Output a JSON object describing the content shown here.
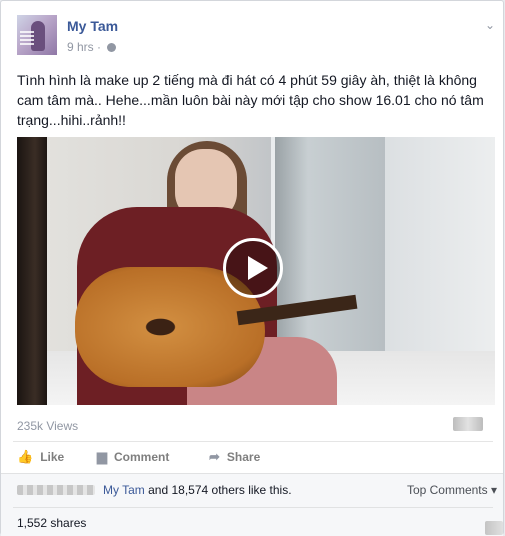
{
  "post": {
    "author": "My Tam",
    "time": "9 hrs",
    "options_icon": "chevron-down-icon",
    "privacy_icon": "globe-icon",
    "text": "Tình hình là make up 2 tiếng mà đi hát có 4 phút 59 giây àh, thiệt là không cam tâm mà.. Hehe...mần luôn bài này mới tập cho show 16.01 cho nó tâm trạng...hihi..rảnh!!",
    "video_views": "235k Views"
  },
  "actions": {
    "like": "Like",
    "comment": "Comment",
    "share": "Share"
  },
  "footer": {
    "likes_name": "My Tam",
    "likes_rest": " and 18,574 others like this.",
    "top_comments": "Top Comments ▾",
    "shares": "1,552 shares"
  },
  "colors": {
    "link": "#3b5998",
    "muted": "#9197a3"
  }
}
